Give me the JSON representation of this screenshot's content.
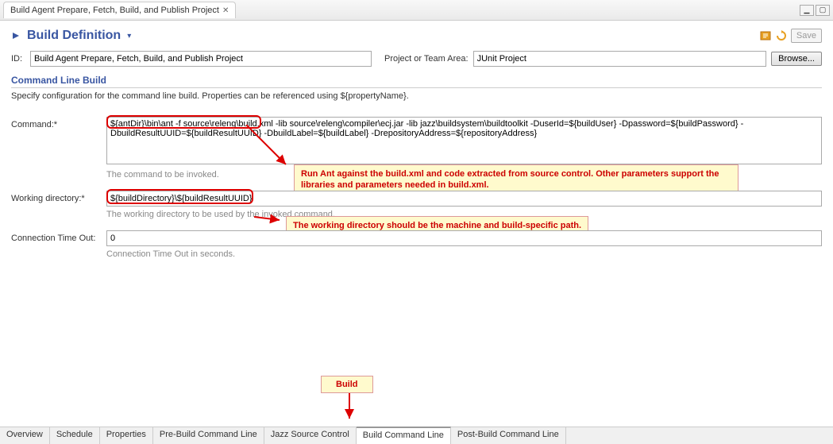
{
  "window": {
    "tab_title": "Build Agent Prepare, Fetch, Build, and Publish Project",
    "minimize": "▁",
    "maximize": "▢"
  },
  "header": {
    "title": "Build Definition",
    "save_label": "Save"
  },
  "id_row": {
    "id_label": "ID:",
    "id_value": "Build Agent Prepare, Fetch, Build, and Publish Project",
    "project_label": "Project or Team Area:",
    "project_value": "JUnit Project",
    "browse_label": "Browse..."
  },
  "section": {
    "title": "Command Line Build",
    "desc": "Specify configuration for the command line build. Properties can be referenced using ${propertyName}."
  },
  "form": {
    "command_label": "Command:*",
    "command_value": "${antDir}\\bin\\ant -f source\\releng\\build.xml -lib source\\releng\\compiler\\ecj.jar -lib jazz\\buildsystem\\buildtoolkit -DuserId=${buildUser} -Dpassword=${buildPassword} -DbuildResultUUID=${buildResultUUID} -DbuildLabel=${buildLabel} -DrepositoryAddress=${repositoryAddress}",
    "command_hint": "The command to be invoked.",
    "workdir_label": "Working directory:*",
    "workdir_value": "${buildDirectory}\\${buildResultUUID}",
    "workdir_hint": "The working directory to be used by the invoked command.",
    "timeout_label": "Connection Time Out:",
    "timeout_value": "0",
    "timeout_hint": "Connection Time Out in seconds."
  },
  "callouts": {
    "command": "Run Ant against the build.xml and code extracted from source control.  Other parameters support the libraries and parameters needed in build.xml.",
    "workdir": "The working directory should be the machine and build-specific path.",
    "build": "Build"
  },
  "tabs": {
    "items": [
      "Overview",
      "Schedule",
      "Properties",
      "Pre-Build Command Line",
      "Jazz Source Control",
      "Build Command Line",
      "Post-Build Command Line"
    ],
    "active": 5
  }
}
